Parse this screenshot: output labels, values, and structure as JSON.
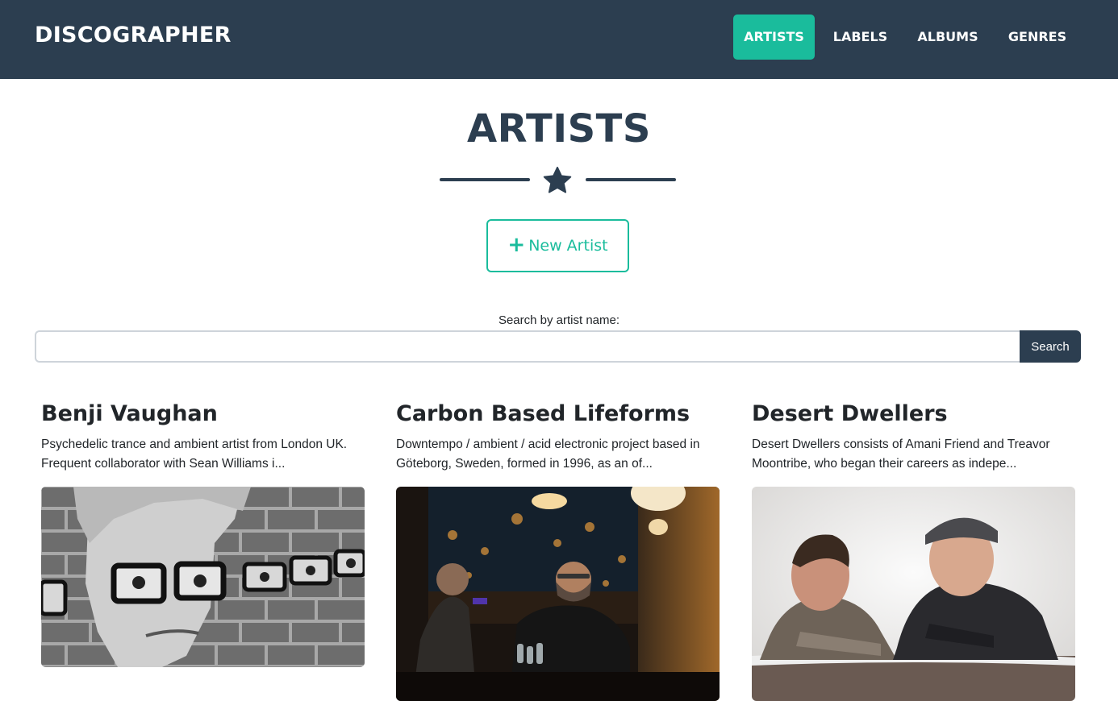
{
  "app": {
    "brand": "DISCOGRAPHER"
  },
  "nav": {
    "items": [
      {
        "label": "ARTISTS",
        "active": true
      },
      {
        "label": "LABELS",
        "active": false
      },
      {
        "label": "ALBUMS",
        "active": false
      },
      {
        "label": "GENRES",
        "active": false
      }
    ]
  },
  "page": {
    "title": "ARTISTS",
    "divider_icon": "star-icon",
    "new_button": {
      "icon": "plus-icon",
      "label": "New Artist"
    }
  },
  "search": {
    "label": "Search by artist name:",
    "value": "",
    "placeholder": "",
    "button_label": "Search"
  },
  "artists": [
    {
      "name": "Benji Vaughan",
      "description": "Psychedelic trance and ambient artist from London UK. Frequent collaborator with Sean Williams i..."
    },
    {
      "name": "Carbon Based Lifeforms",
      "description": "Downtempo / ambient / acid electronic project based in Göteborg, Sweden, formed in 1996, as an of..."
    },
    {
      "name": "Desert Dwellers",
      "description": "Desert Dwellers consists of Amani Friend and Treavor Moontribe, who began their careers as indepe..."
    }
  ],
  "colors": {
    "navbar": "#2c3e50",
    "accent": "#1abc9c",
    "text": "#212529"
  }
}
